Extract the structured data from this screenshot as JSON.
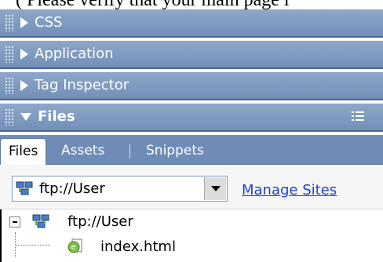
{
  "top_note": "( Please verify that your main page i",
  "panels": [
    {
      "label": "CSS",
      "expanded": false
    },
    {
      "label": "Application",
      "expanded": false
    },
    {
      "label": "Tag Inspector",
      "expanded": false
    },
    {
      "label": "Files",
      "expanded": true
    }
  ],
  "tabs": [
    "Files",
    "Assets",
    "Snippets"
  ],
  "toolbar": {
    "site_value": "ftp://User",
    "manage_sites_label": "Manage Sites"
  },
  "tree": {
    "root_label": "ftp://User",
    "child_label": "index.html"
  },
  "icons": {
    "site": "site-icon",
    "html_file": "html-file-icon",
    "options": "options-icon"
  }
}
